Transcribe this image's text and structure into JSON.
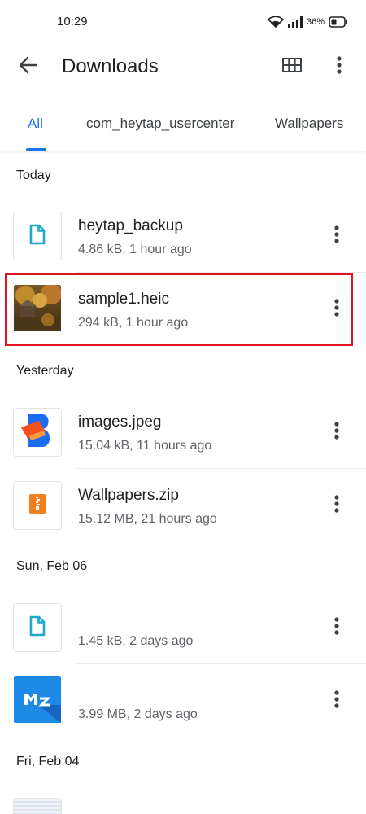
{
  "status_bar": {
    "time": "10:29",
    "battery_percent": "36%",
    "icons": [
      "wifi-icon",
      "signal-icon",
      "battery-icon"
    ]
  },
  "app_bar": {
    "title": "Downloads",
    "icons": [
      "back-arrow-icon",
      "grid-view-icon",
      "more-vert-icon"
    ]
  },
  "tabs": [
    {
      "label": "All",
      "active": true
    },
    {
      "label": "com_heytap_usercenter",
      "active": false
    },
    {
      "label": "Wallpapers",
      "active": false
    }
  ],
  "sections": [
    {
      "header": "Today",
      "files": [
        {
          "name": "heytap_backup",
          "meta": "4.86 kB, 1 hour ago",
          "icon": "doc-icon"
        },
        {
          "name": "sample1.heic",
          "meta": "294 kB, 1 hour ago",
          "icon": "photo-thumbnail",
          "highlighted": true
        }
      ]
    },
    {
      "header": "Yesterday",
      "files": [
        {
          "name": "images.jpeg",
          "meta": "15.04 kB, 11 hours ago",
          "icon": "b-logo-thumbnail"
        },
        {
          "name": "Wallpapers.zip",
          "meta": "15.12 MB, 21 hours ago",
          "icon": "zip-icon"
        }
      ]
    },
    {
      "header": "Sun, Feb 06",
      "files": [
        {
          "name": "",
          "meta": "1.45 kB, 2 days ago",
          "icon": "doc-icon"
        },
        {
          "name": "",
          "meta": "3.99 MB, 2 days ago",
          "icon": "app-logo-thumbnail"
        }
      ]
    },
    {
      "header": "Fri, Feb 04",
      "files": []
    }
  ],
  "colors": {
    "accent": "#1a73e8",
    "highlight": "#e0141e",
    "doc_icon": "#1fa8c9",
    "zip_icon": "#f37c20",
    "app_logo_bg": "#1e88e5"
  }
}
